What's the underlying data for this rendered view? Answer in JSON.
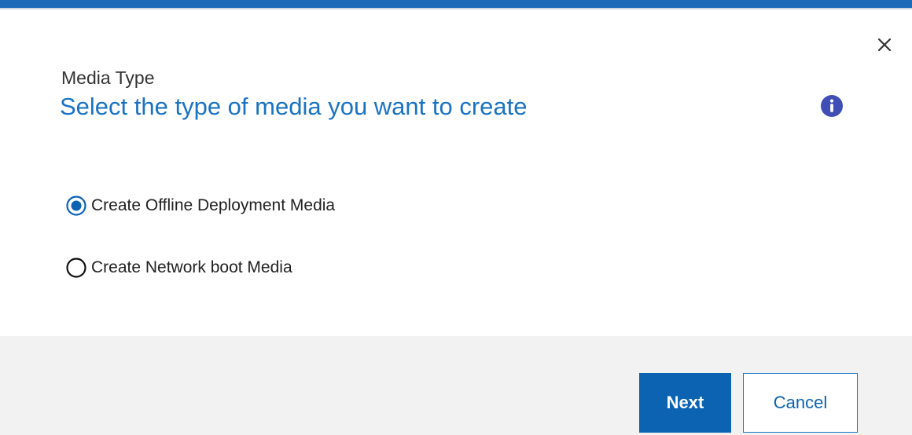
{
  "header": {
    "accent_color": "#1d6ab8",
    "close_icon": "close-icon"
  },
  "content": {
    "eyebrow": "Media Type",
    "title": "Select the type of media you want to create",
    "info_icon": "info-icon",
    "title_color": "#1a73c2"
  },
  "options": [
    {
      "label": "Create Offline Deployment Media",
      "selected": true
    },
    {
      "label": "Create Network boot Media",
      "selected": false
    }
  ],
  "footer": {
    "next_label": "Next",
    "cancel_label": "Cancel",
    "primary_color": "#0b63b2"
  }
}
